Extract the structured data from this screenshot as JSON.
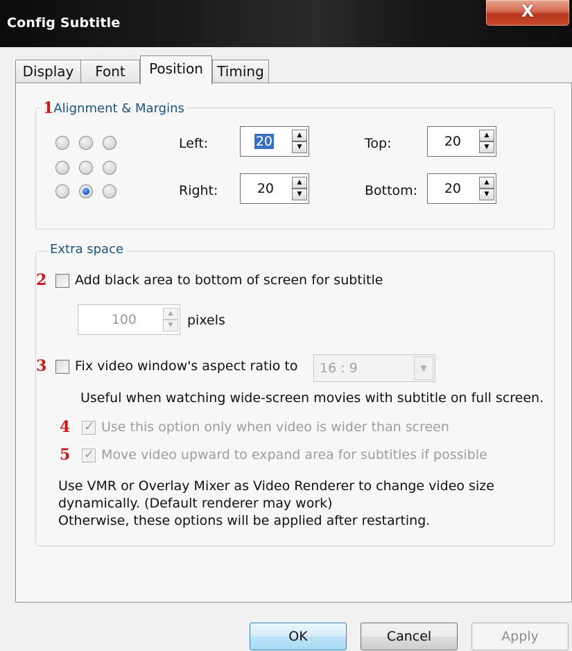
{
  "window": {
    "title": "Config Subtitle",
    "close_glyph": "X"
  },
  "tabs": [
    {
      "label": "Display"
    },
    {
      "label": "Font"
    },
    {
      "label": "Position",
      "active": true
    },
    {
      "label": "Timing"
    }
  ],
  "alignment": {
    "marker": "1",
    "title": "Alignment & Margins",
    "selected_position": "bottom-center",
    "left": {
      "label": "Left:",
      "value": "20"
    },
    "top": {
      "label": "Top:",
      "value": "20"
    },
    "right": {
      "label": "Right:",
      "value": "20"
    },
    "bottom": {
      "label": "Bottom:",
      "value": "20"
    }
  },
  "extra_space": {
    "title": "Extra space",
    "black_area": {
      "marker": "2",
      "label": "Add black area to bottom of screen for subtitle",
      "checked": false,
      "pixels_value": "100",
      "pixels_label": "pixels"
    },
    "aspect": {
      "marker": "3",
      "label": "Fix video window's aspect ratio to",
      "checked": false,
      "ratio": "16 : 9",
      "hint": "Useful when watching wide-screen movies with subtitle on full screen."
    },
    "only_wider": {
      "marker": "4",
      "label": "Use this option only when video is wider than screen",
      "checked": true,
      "disabled": true
    },
    "move_up": {
      "marker": "5",
      "label": "Move video upward to expand area for subtitles if possible",
      "checked": true,
      "disabled": true
    },
    "note": {
      "line1": "Use VMR or Overlay Mixer as Video Renderer to change video size",
      "line2": "dynamically. (Default renderer may work)",
      "line3": "Otherwise, these options will be applied after restarting."
    }
  },
  "buttons": {
    "ok": "OK",
    "cancel": "Cancel",
    "apply": "Apply"
  },
  "colors": {
    "marker": "#cc1a1a",
    "group_title": "#1c5180",
    "selection": "#3b6fc4"
  }
}
